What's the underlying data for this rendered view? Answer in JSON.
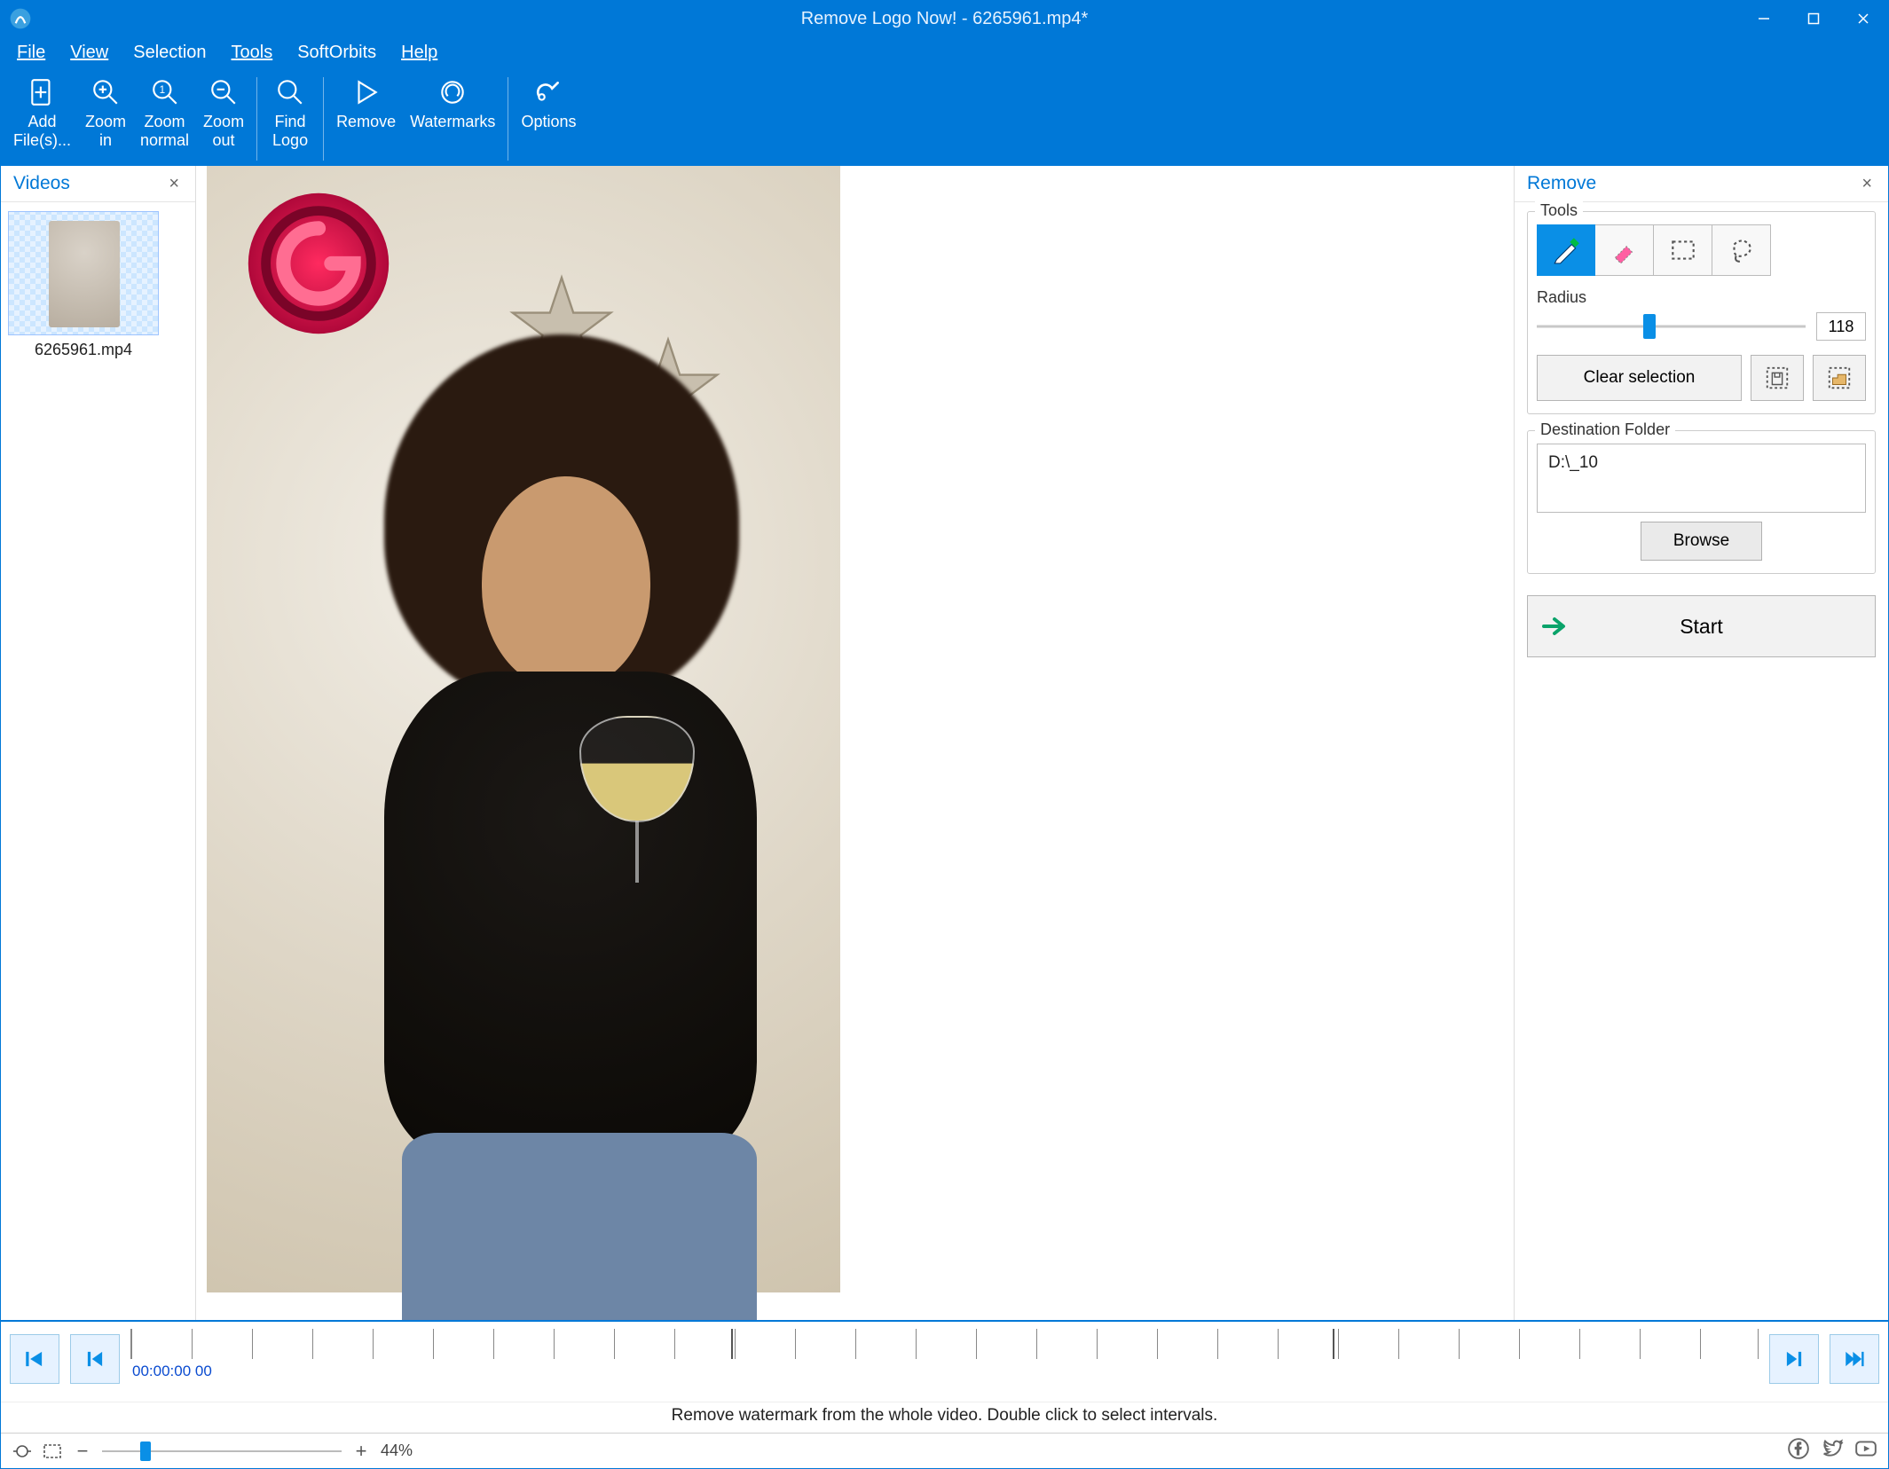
{
  "titlebar": {
    "title": "Remove Logo Now! - 6265961.mp4*"
  },
  "menu": {
    "file": "File",
    "view": "View",
    "selection": "Selection",
    "tools": "Tools",
    "softorbits": "SoftOrbits",
    "help": "Help"
  },
  "toolbar": {
    "add": "Add\nFile(s)...",
    "zoom_in": "Zoom\nin",
    "zoom_normal": "Zoom\nnormal",
    "zoom_out": "Zoom\nout",
    "find_logo": "Find\nLogo",
    "remove": "Remove",
    "watermarks": "Watermarks",
    "options": "Options"
  },
  "videos_panel": {
    "title": "Videos",
    "items": [
      {
        "name": "6265961.mp4"
      }
    ]
  },
  "remove_panel": {
    "title": "Remove",
    "tools_label": "Tools",
    "radius_label": "Radius",
    "radius_value": "118",
    "radius_pct": 42,
    "clear_selection": "Clear selection",
    "dest_label": "Destination Folder",
    "dest_value": "D:\\_10",
    "browse": "Browse",
    "start": "Start"
  },
  "timeline": {
    "time": "00:00:00 00",
    "hint": "Remove watermark from the whole video. Double click to select intervals."
  },
  "statusbar": {
    "zoom_pct_pos": 18,
    "zoom_label": "44%"
  }
}
